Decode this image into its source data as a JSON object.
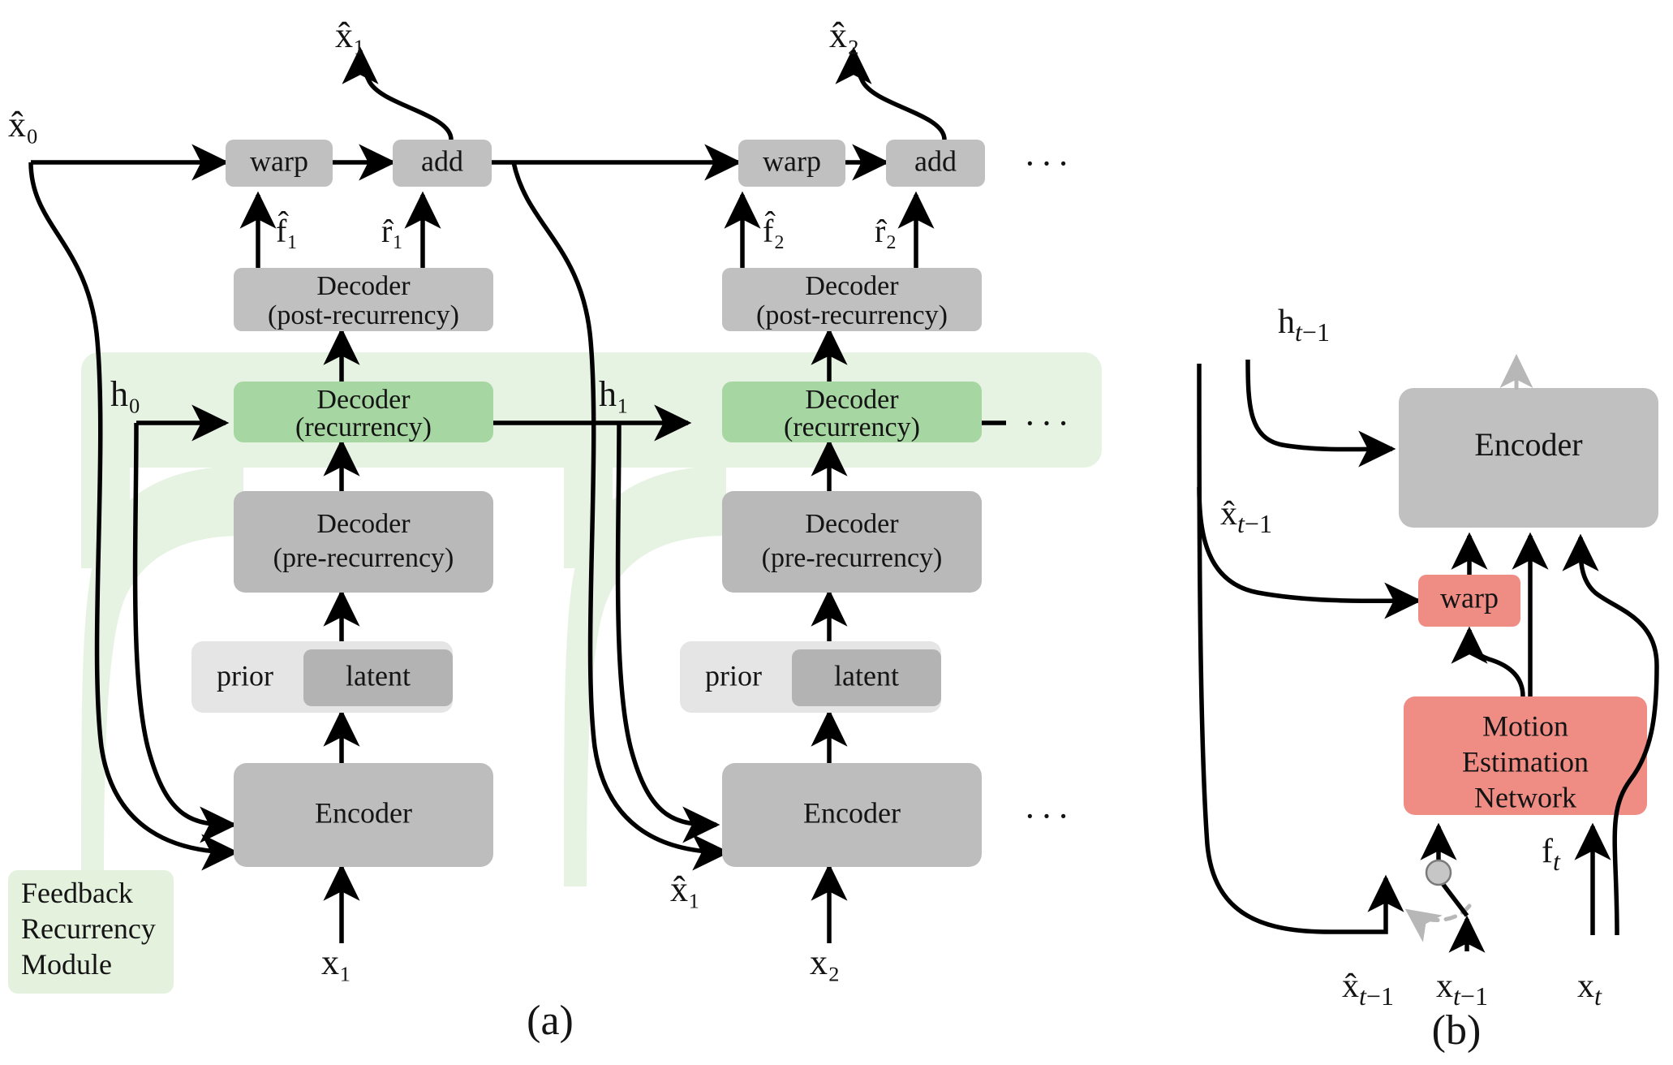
{
  "figure": {
    "panel_a_label": "(a)",
    "panel_b_label": "(b)",
    "ellipsis": "···"
  },
  "colors": {
    "gray_box": "#c0c0c0",
    "gray_box_dark": "#b3b3b3",
    "prior_box": "#e5e5e5",
    "green_box": "#a6d6a2",
    "green_band": "#e7f3e2",
    "red_box": "#ef8c84",
    "legend_bg": "#e3f1dd",
    "stroke": "#000000",
    "dashed_gray": "#b7b7b7",
    "switch_node": "#c6c6c6"
  },
  "panel_a": {
    "legend": {
      "line1": "Feedback",
      "line2": "Recurrency",
      "line3": "Module"
    },
    "timesteps": [
      {
        "index": 1,
        "warp_label": "warp",
        "add_label": "add",
        "decoder_post_line1": "Decoder",
        "decoder_post_line2": "(post-recurrency)",
        "decoder_rec_line1": "Decoder",
        "decoder_rec_line2": "(recurrency)",
        "decoder_pre_line1": "Decoder",
        "decoder_pre_line2": "(pre-recurrency)",
        "prior_label": "prior",
        "latent_label": "latent",
        "encoder_label": "Encoder",
        "input_label": "x₁",
        "output_label": "x̂₁",
        "flow_label": "f̂₁",
        "residual_label": "r̂₁",
        "hidden_in_label": "h₀",
        "prev_recon_label": "x̂₀"
      },
      {
        "index": 2,
        "warp_label": "warp",
        "add_label": "add",
        "decoder_post_line1": "Decoder",
        "decoder_post_line2": "(post-recurrency)",
        "decoder_rec_line1": "Decoder",
        "decoder_rec_line2": "(recurrency)",
        "decoder_pre_line1": "Decoder",
        "decoder_pre_line2": "(pre-recurrency)",
        "prior_label": "prior",
        "latent_label": "latent",
        "encoder_label": "Encoder",
        "input_label": "x₂",
        "output_label": "x̂₂",
        "flow_label": "f̂₂",
        "residual_label": "r̂₂",
        "hidden_in_label": "h₁",
        "prev_recon_label": "x̂₁"
      }
    ]
  },
  "panel_b": {
    "encoder_label": "Encoder",
    "warp_label": "warp",
    "motion_line1": "Motion",
    "motion_line2": "Estimation",
    "motion_line3": "Network",
    "hidden_label": "h_{t-1}",
    "recon_prev_label": "x̂_{t-1}",
    "flow_label": "f_t",
    "input_recon_prev_label": "x̂_{t-1}",
    "input_prev_label": "x_{t-1}",
    "input_cur_label": "x_t"
  }
}
